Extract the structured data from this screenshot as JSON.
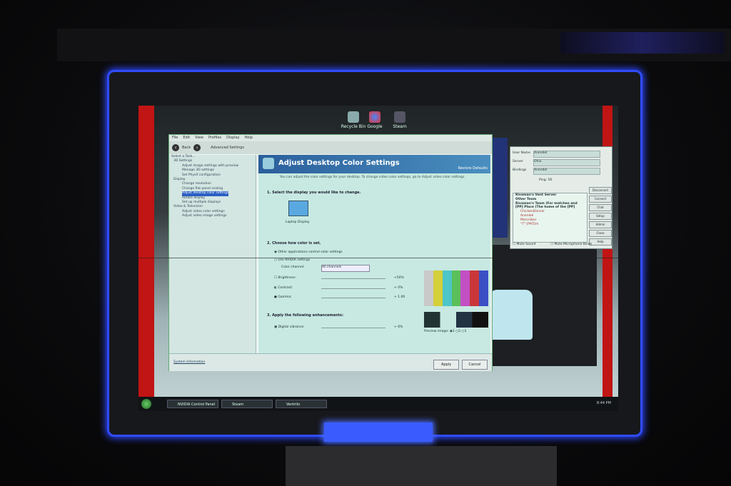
{
  "desktop": {
    "icons": [
      {
        "name": "recycle-bin",
        "label": "Recycle Bin"
      },
      {
        "name": "google",
        "label": "Google"
      },
      {
        "name": "steam",
        "label": "Steam"
      }
    ]
  },
  "nvidia": {
    "menu": [
      "File",
      "Edit",
      "View",
      "Profiles",
      "Display",
      "Help"
    ],
    "back_label": "Back",
    "advanced_settings": "Advanced Settings",
    "task_header": "Select a Task...",
    "tree": [
      {
        "label": "3D Settings",
        "indent": 0,
        "selected": false
      },
      {
        "label": "Adjust image settings with preview",
        "indent": 1,
        "selected": false
      },
      {
        "label": "Manage 3D settings",
        "indent": 1,
        "selected": false
      },
      {
        "label": "Set PhysX configuration",
        "indent": 1,
        "selected": false
      },
      {
        "label": "Display",
        "indent": 0,
        "selected": false
      },
      {
        "label": "Change resolution",
        "indent": 1,
        "selected": false
      },
      {
        "label": "Change flat panel scaling",
        "indent": 1,
        "selected": false
      },
      {
        "label": "Adjust desktop color settings",
        "indent": 1,
        "selected": true
      },
      {
        "label": "Rotate display",
        "indent": 1,
        "selected": false
      },
      {
        "label": "Set up multiple displays",
        "indent": 1,
        "selected": false
      },
      {
        "label": "Video & Television",
        "indent": 0,
        "selected": false
      },
      {
        "label": "Adjust video color settings",
        "indent": 1,
        "selected": false
      },
      {
        "label": "Adjust video image settings",
        "indent": 1,
        "selected": false
      }
    ],
    "title": "Adjust Desktop Color Settings",
    "restore": "Restore Defaults",
    "description": "You can adjust the color settings for your desktop. To change video color settings, go to Adjust video color settings",
    "step1": "1. Select the display you would like to change.",
    "display_label": "Laptop Display",
    "step2": "2. Choose how color is set.",
    "opt_other": "Other applications control color settings",
    "opt_nvidia": "Use NVIDIA settings",
    "color_channel_label": "Color channel:",
    "color_channel_value": "All channels",
    "brightness_label": "Brightness:",
    "brightness_value": "+50%",
    "contrast_label": "Contrast:",
    "contrast_value": "+ 0%",
    "gamma_label": "Gamma:",
    "gamma_value": "+ 1.00",
    "step3": "3. Apply the following enhancements:",
    "vibrance_label": "Digital vibrance:",
    "vibrance_value": "+ 6%",
    "preview_label": "Preview image:",
    "preview_options": [
      "1",
      "2",
      "3"
    ],
    "system_info": "System Information",
    "apply": "Apply",
    "cancel": "Cancel",
    "colors": {
      "bars": [
        "#c9c9c9",
        "#d4cf3a",
        "#4dc5c9",
        "#5bbf5a",
        "#c24fc4",
        "#c9373a",
        "#3a4fc4"
      ]
    }
  },
  "ventrilo": {
    "user_name_label": "User Name",
    "user_name_value": "Anendel",
    "server_label": "Server",
    "server_value": "Ohio",
    "bindings_label": "Bindings",
    "bindings_value": "Anendel",
    "ping": "Ping: 56",
    "channels": [
      "Rivaman's Vent Server",
      "Other Team",
      "Rivaman's Team (For matches and",
      "[PP] Place (The home of the [PP]",
      "ChickenDancer",
      "Anendel",
      "Marcnibor",
      "\"T\" [PP]Tim"
    ],
    "buttons": [
      "Disconnect",
      "Connect",
      "Chat",
      "Setup",
      "Admin",
      "Close",
      "Help"
    ],
    "mute_sound": "Mute Sound",
    "mute_mic": "Mute Microphone Binds"
  },
  "taskbar": {
    "items": [
      "NVIDIA Control Panel",
      "Steam",
      "Ventrilo"
    ],
    "clock": "8:44 PM"
  }
}
